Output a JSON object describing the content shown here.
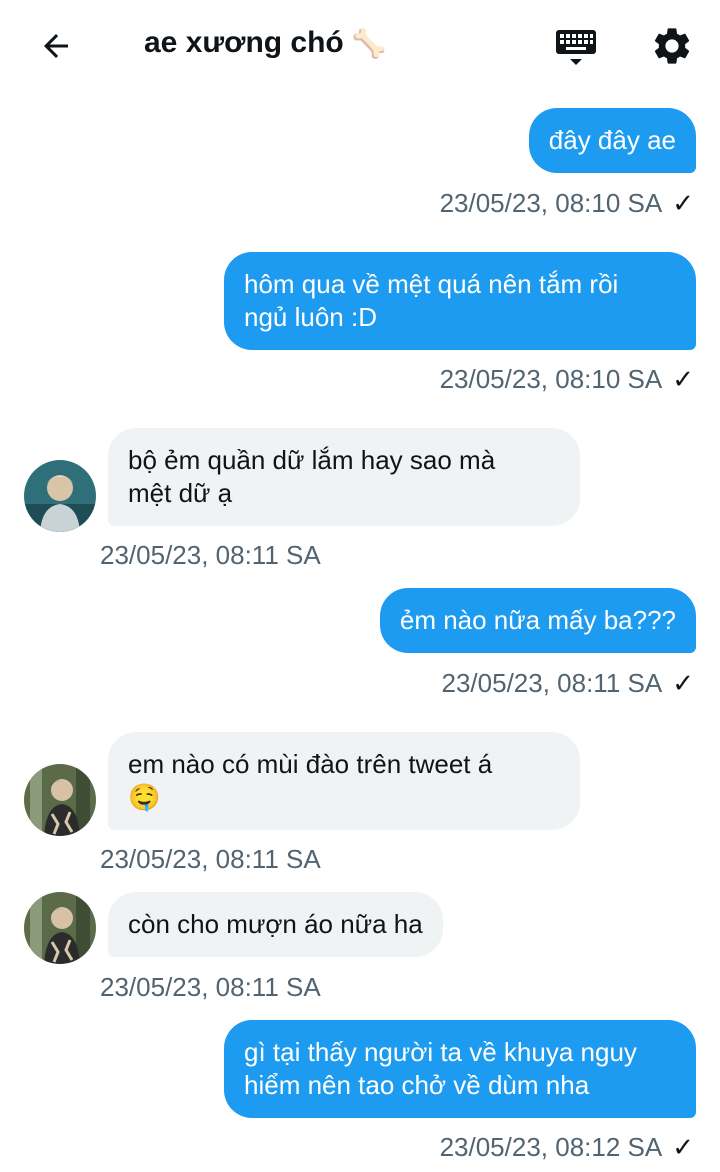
{
  "header": {
    "title": "ae xương chó",
    "title_emoji": "🦴"
  },
  "icons": {
    "back": "arrow-left-icon",
    "keyboard": "keyboard-icon",
    "settings": "gear-icon"
  },
  "colors": {
    "outgoing_bubble": "#1d9bf0",
    "incoming_bubble": "#eff3f4",
    "timestamp": "#536471"
  },
  "messages": [
    {
      "dir": "out",
      "text": "đây đây ae",
      "time": "23/05/23, 08:10 SA",
      "read": "✓"
    },
    {
      "dir": "out",
      "text": "hôm qua về mệt quá nên tắm rồi\nngủ luôn :D",
      "time": "23/05/23, 08:10 SA",
      "read": "✓"
    },
    {
      "dir": "in",
      "text": "bộ ẻm quần dữ lắm hay sao mà\nmệt dữ ạ",
      "time": "23/05/23, 08:11 SA"
    },
    {
      "dir": "out",
      "text": "ẻm nào nữa mấy ba???",
      "time": "23/05/23, 08:11 SA",
      "read": "✓"
    },
    {
      "dir": "in",
      "text": "em nào có mùi đào trên tweet á\n🤤",
      "time": "23/05/23, 08:11 SA"
    },
    {
      "dir": "in",
      "text": "còn cho mượn áo nữa ha",
      "time": "23/05/23, 08:11 SA"
    },
    {
      "dir": "out",
      "text": "gì tại thấy người ta về khuya nguy\nhiểm nên tao chở về dùm nha",
      "time": "23/05/23, 08:12 SA",
      "read": "✓"
    }
  ]
}
